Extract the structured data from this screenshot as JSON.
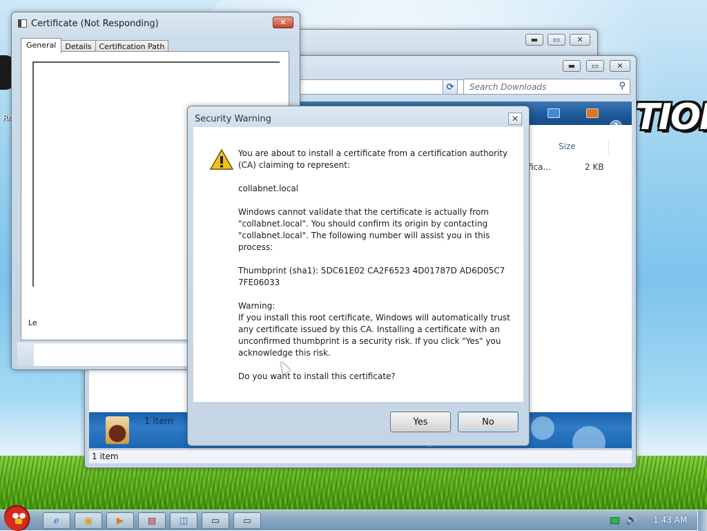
{
  "desktop": {
    "brand_fragment": "TION",
    "icon_label_fragment": "Re"
  },
  "downloads_window": {
    "search_placeholder": "Search Downloads",
    "column_size": "Size",
    "file_name_fragment": "fica...",
    "file_size": "2 KB",
    "details_count": "1 item",
    "status_text": "1 item"
  },
  "certificate_window": {
    "title": "Certificate (Not Responding)",
    "tabs": [
      "General",
      "Details",
      "Certification Path"
    ],
    "text_fragment": "Le"
  },
  "security_warning": {
    "title": "Security Warning",
    "paragraphs": [
      "You are about to install a certificate from a certification authority\n(CA) claiming to represent:",
      "collabnet.local",
      "Windows cannot validate that the certificate is actually from\n\"collabnet.local\". You should confirm its origin by contacting\n\"collabnet.local\". The following number will assist you in this\nprocess:",
      "Thumbprint (sha1): 5DC61E02 CA2F6523 4D01787D AD6D05C7\n7FE06033",
      "Warning:\nIf you install this root certificate, Windows will automatically trust\nany certificate issued by this CA. Installing a certificate with an\nunconfirmed thumbprint is a security risk. If you click \"Yes\" you\nacknowledge this risk.",
      "Do you want to install this certificate?"
    ],
    "yes_label": "Yes",
    "no_label": "No"
  },
  "taskbar": {
    "clock": "1:43 AM"
  }
}
